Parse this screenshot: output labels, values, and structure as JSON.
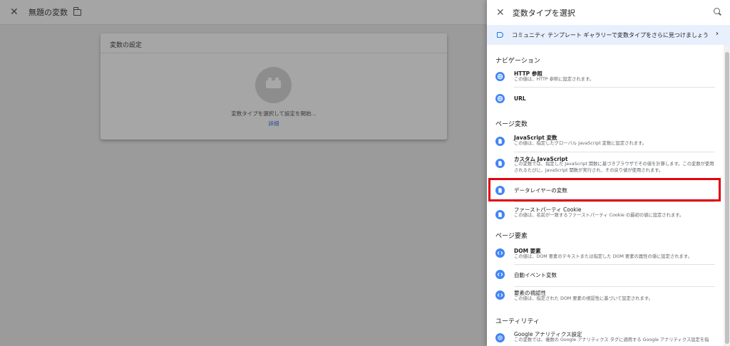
{
  "background": {
    "title": "無題の変数",
    "card_heading": "変数の設定",
    "card_prompt": "変数タイプを選択して設定を開始...",
    "card_link": "詳細"
  },
  "panel": {
    "title": "変数タイプを選択",
    "banner": "コミュニティ テンプレート ギャラリーで変数タイプをさらに見つけましょう",
    "sections": [
      {
        "heading": "ナビゲーション",
        "items": [
          {
            "name": "HTTP 参照",
            "desc": "この値は、HTTP 参照に設定されます。",
            "icon": "globe-icon"
          },
          {
            "name": "URL",
            "desc": "",
            "icon": "globe-icon"
          }
        ]
      },
      {
        "heading": "ページ変数",
        "items": [
          {
            "name": "JavaScript 変数",
            "desc": "この値は、指定したグローバル JavaScript 変数に設定されます。",
            "icon": "document-icon"
          },
          {
            "name": "カスタム JavaScript",
            "desc": "この変数では、指定した JavaScript 関数に基づきブラウザでその値を計算します。この変数が使用されるたびに、JavaScript 関数が実行され、その戻り値が使用されます。",
            "icon": "document-icon"
          },
          {
            "name": "データレイヤーの変数",
            "desc": "",
            "icon": "document-icon"
          },
          {
            "name": "ファーストパーティ Cookie",
            "desc": "この値は、名前が一致するファーストパーティ Cookie の最初の値に設定されます。",
            "icon": "document-icon"
          }
        ]
      },
      {
        "heading": "ページ要素",
        "items": [
          {
            "name": "DOM 要素",
            "desc": "この値は、DOM 要素のテキストまたは指定した DOM 要素の属性の値に設定されます。",
            "icon": "code-icon"
          },
          {
            "name": "自動イベント変数",
            "desc": "",
            "icon": "code-icon"
          },
          {
            "name": "要素の視認性",
            "desc": "この値は、指定された DOM 要素の視認性に基づいて設定されます。",
            "icon": "code-icon"
          }
        ]
      },
      {
        "heading": "ユーティリティ",
        "items": [
          {
            "name": "Google アナリティクス設定",
            "desc": "この変数では、複数の Google アナリティクス タグに適用する Google アナリティクス設定を指",
            "icon": "gear-icon"
          }
        ]
      }
    ]
  },
  "colors": {
    "accent": "#1a73e8",
    "icon_blue": "#4285f4",
    "highlight": "#e3000f",
    "banner_bg": "#e8f0fe"
  }
}
